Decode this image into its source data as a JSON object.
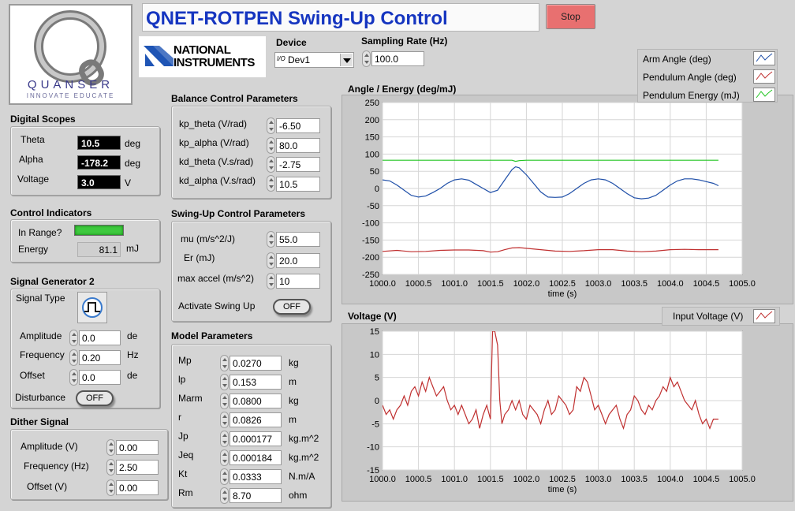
{
  "title": "QNET-ROTPEN Swing-Up Control",
  "stop_label": "Stop",
  "logo": {
    "brand": "QUANSER",
    "tagline": "INNOVATE EDUCATE",
    "ni_line1": "NATIONAL",
    "ni_line2": "INSTRUMENTS"
  },
  "device": {
    "label": "Device",
    "value": "Dev1",
    "prefix": "I/O"
  },
  "sampling": {
    "label": "Sampling Rate (Hz)",
    "value": "100.0"
  },
  "digital_scopes": {
    "title": "Digital Scopes",
    "rows": [
      {
        "label": "Theta",
        "value": "10.5",
        "unit": "deg"
      },
      {
        "label": "Alpha",
        "value": "-178.2",
        "unit": "deg"
      },
      {
        "label": "Voltage",
        "value": "3.0",
        "unit": "V"
      }
    ]
  },
  "control_indicators": {
    "title": "Control Indicators",
    "in_range_label": "In Range?",
    "in_range_on": true,
    "led_color": "#3ec93e",
    "energy_label": "Energy",
    "energy_value": "81.1",
    "energy_unit": "mJ"
  },
  "signal_generator": {
    "title": "Signal Generator 2",
    "type_label": "Signal Type",
    "type_icon": "square-wave-icon",
    "rows": [
      {
        "label": "Amplitude",
        "value": "0.0",
        "unit": "de"
      },
      {
        "label": "Frequency",
        "value": "0.20",
        "unit": "Hz"
      },
      {
        "label": "Offset",
        "value": "0.0",
        "unit": "de"
      }
    ],
    "disturbance_label": "Disturbance",
    "disturbance_state": "OFF"
  },
  "dither": {
    "title": "Dither Signal",
    "rows": [
      {
        "label": "Amplitude (V)",
        "value": "0.00"
      },
      {
        "label": "Frequency (Hz)",
        "value": "2.50"
      },
      {
        "label": "Offset (V)",
        "value": "0.00"
      }
    ]
  },
  "balance": {
    "title": "Balance Control Parameters",
    "rows": [
      {
        "label": "kp_theta (V/rad)",
        "value": "-6.50"
      },
      {
        "label": "kp_alpha (V/rad)",
        "value": "80.0"
      },
      {
        "label": "kd_theta (V.s/rad)",
        "value": "-2.75"
      },
      {
        "label": "kd_alpha (V.s/rad)",
        "value": "10.5"
      }
    ]
  },
  "swingup": {
    "title": "Swing-Up Control Parameters",
    "rows": [
      {
        "label": "mu (m/s^2/J)",
        "value": "55.0"
      },
      {
        "label": "Er (mJ)",
        "value": "20.0"
      },
      {
        "label": "max accel (m/s^2)",
        "value": "10"
      }
    ],
    "activate_label": "Activate Swing Up",
    "activate_state": "OFF"
  },
  "model": {
    "title": "Model Parameters",
    "rows": [
      {
        "label": "Mp",
        "value": "0.0270",
        "unit": "kg"
      },
      {
        "label": "lp",
        "value": "0.153",
        "unit": "m"
      },
      {
        "label": "Marm",
        "value": "0.0800",
        "unit": "kg"
      },
      {
        "label": "r",
        "value": "0.0826",
        "unit": "m"
      },
      {
        "label": "Jp",
        "value": "0.000177",
        "unit": "kg.m^2"
      },
      {
        "label": "Jeq",
        "value": "0.000184",
        "unit": "kg.m^2"
      },
      {
        "label": "Kt",
        "value": "0.0333",
        "unit": "N.m/A"
      },
      {
        "label": "Rm",
        "value": "8.70",
        "unit": "ohm"
      }
    ]
  },
  "chart_data": [
    {
      "type": "line",
      "title": "Angle / Energy (deg/mJ)",
      "xlabel": "time (s)",
      "ylabel": "",
      "xlim": [
        1000.0,
        1005.0
      ],
      "ylim": [
        -250,
        250
      ],
      "xticks": [
        "1000.0",
        "1000.5",
        "1001.0",
        "1001.5",
        "1002.0",
        "1002.5",
        "1003.0",
        "1003.5",
        "1004.0",
        "1004.5",
        "1005.0"
      ],
      "yticks": [
        "250",
        "200",
        "150",
        "100",
        "50",
        "0",
        "-50",
        "-100",
        "-150",
        "-200",
        "-250"
      ],
      "grid": true,
      "legend_position": "top-right",
      "series": [
        {
          "name": "Arm Angle (deg)",
          "color": "#1f4fa8",
          "x": [
            1000.0,
            1000.1,
            1000.2,
            1000.3,
            1000.4,
            1000.5,
            1000.6,
            1000.7,
            1000.8,
            1000.9,
            1001.0,
            1001.1,
            1001.2,
            1001.3,
            1001.4,
            1001.5,
            1001.6,
            1001.7,
            1001.8,
            1001.85,
            1001.9,
            1002.0,
            1002.1,
            1002.2,
            1002.3,
            1002.4,
            1002.5,
            1002.6,
            1002.7,
            1002.8,
            1002.9,
            1003.0,
            1003.1,
            1003.2,
            1003.3,
            1003.4,
            1003.5,
            1003.6,
            1003.7,
            1003.8,
            1003.9,
            1004.0,
            1004.1,
            1004.2,
            1004.3,
            1004.4,
            1004.5,
            1004.6,
            1004.67
          ],
          "y": [
            25,
            22,
            10,
            -5,
            -20,
            -25,
            -22,
            -12,
            0,
            15,
            25,
            28,
            24,
            12,
            0,
            -12,
            -5,
            25,
            55,
            63,
            60,
            40,
            15,
            -10,
            -25,
            -26,
            -25,
            -15,
            0,
            15,
            25,
            28,
            25,
            15,
            0,
            -15,
            -27,
            -30,
            -28,
            -20,
            -5,
            10,
            22,
            28,
            28,
            25,
            20,
            15,
            8
          ]
        },
        {
          "name": "Pendulum Angle (deg)",
          "color": "#c03030",
          "x": [
            1000.0,
            1000.2,
            1000.4,
            1000.6,
            1000.8,
            1001.0,
            1001.2,
            1001.4,
            1001.5,
            1001.6,
            1001.7,
            1001.8,
            1001.9,
            1002.0,
            1002.2,
            1002.4,
            1002.6,
            1002.8,
            1003.0,
            1003.2,
            1003.4,
            1003.6,
            1003.8,
            1004.0,
            1004.2,
            1004.4,
            1004.67
          ],
          "y": [
            -183,
            -180,
            -184,
            -183,
            -180,
            -179,
            -179,
            -181,
            -185,
            -184,
            -178,
            -173,
            -172,
            -174,
            -178,
            -182,
            -183,
            -181,
            -178,
            -178,
            -182,
            -184,
            -182,
            -178,
            -177,
            -178,
            -178
          ]
        },
        {
          "name": "Pendulum Energy (mJ)",
          "color": "#22c522",
          "x": [
            1000.0,
            1001.5,
            1001.8,
            1001.85,
            1001.9,
            1002.0,
            1004.67
          ],
          "y": [
            82,
            82,
            82,
            79,
            81,
            82,
            82
          ]
        }
      ]
    },
    {
      "type": "line",
      "title": "Voltage (V)",
      "xlabel": "time (s)",
      "ylabel": "",
      "xlim": [
        1000.0,
        1005.0
      ],
      "ylim": [
        -15,
        15
      ],
      "xticks": [
        "1000.0",
        "1000.5",
        "1001.0",
        "1001.5",
        "1002.0",
        "1002.5",
        "1003.0",
        "1003.5",
        "1004.0",
        "1004.5",
        "1005.0"
      ],
      "yticks": [
        "15",
        "10",
        "5",
        "0",
        "-5",
        "-10",
        "-15"
      ],
      "grid": true,
      "legend_position": "top-right",
      "series": [
        {
          "name": "Input Voltage (V)",
          "color": "#c03030",
          "x": [
            1000.0,
            1000.05,
            1000.1,
            1000.15,
            1000.2,
            1000.25,
            1000.3,
            1000.35,
            1000.4,
            1000.45,
            1000.5,
            1000.55,
            1000.6,
            1000.65,
            1000.7,
            1000.75,
            1000.8,
            1000.85,
            1000.9,
            1000.95,
            1001.0,
            1001.05,
            1001.1,
            1001.15,
            1001.2,
            1001.25,
            1001.3,
            1001.35,
            1001.4,
            1001.45,
            1001.5,
            1001.53,
            1001.56,
            1001.6,
            1001.63,
            1001.66,
            1001.7,
            1001.75,
            1001.8,
            1001.85,
            1001.9,
            1001.95,
            1002.0,
            1002.05,
            1002.1,
            1002.15,
            1002.2,
            1002.25,
            1002.3,
            1002.35,
            1002.4,
            1002.45,
            1002.5,
            1002.55,
            1002.6,
            1002.65,
            1002.7,
            1002.75,
            1002.8,
            1002.85,
            1002.9,
            1002.95,
            1003.0,
            1003.05,
            1003.1,
            1003.15,
            1003.2,
            1003.25,
            1003.3,
            1003.35,
            1003.4,
            1003.45,
            1003.5,
            1003.55,
            1003.6,
            1003.65,
            1003.7,
            1003.75,
            1003.8,
            1003.85,
            1003.9,
            1003.95,
            1004.0,
            1004.05,
            1004.1,
            1004.15,
            1004.2,
            1004.25,
            1004.3,
            1004.35,
            1004.4,
            1004.45,
            1004.5,
            1004.55,
            1004.6,
            1004.67
          ],
          "y": [
            -1,
            -3,
            -2,
            -4,
            -2,
            -1,
            1,
            -1,
            2,
            3,
            1,
            4,
            2,
            5,
            3,
            1,
            2,
            3,
            0,
            -2,
            -1,
            -3,
            -1,
            -3,
            -5,
            -4,
            -2,
            -6,
            -3,
            -1,
            -4,
            15,
            15,
            12,
            0,
            -5,
            -3,
            -2,
            0,
            -2,
            0,
            -3,
            -4,
            -1,
            -2,
            -3,
            -5,
            -2,
            0,
            -3,
            -2,
            1,
            0,
            -1,
            -3,
            -2,
            3,
            2,
            5,
            4,
            1,
            -2,
            -1,
            -3,
            -5,
            -3,
            -2,
            -1,
            -4,
            -6,
            -3,
            -2,
            1,
            0,
            -2,
            -3,
            -1,
            -2,
            0,
            1,
            3,
            2,
            5,
            3,
            4,
            2,
            0,
            -1,
            -2,
            0,
            -3,
            -5,
            -4,
            -6,
            -4,
            -4
          ]
        }
      ]
    }
  ]
}
